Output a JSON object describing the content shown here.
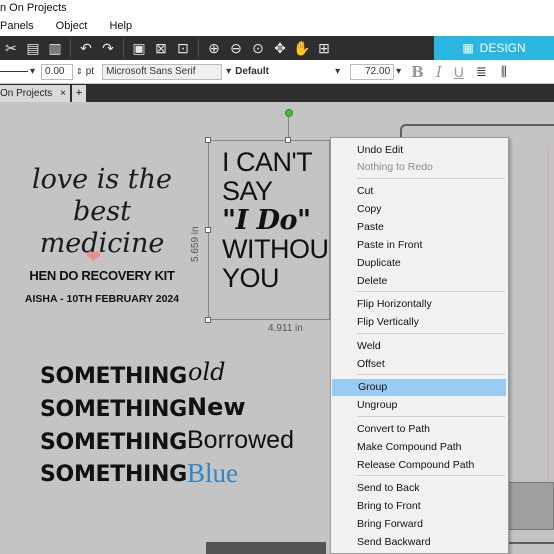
{
  "window": {
    "title": "n On Projects"
  },
  "menu": {
    "items": [
      "Panels",
      "Object",
      "Help"
    ]
  },
  "toolbar": {
    "design_label": "DESIGN"
  },
  "props": {
    "line_value": "0.00",
    "line_unit": "pt",
    "font": "Microsoft Sans Serif",
    "style": "Default",
    "size": "72.00"
  },
  "tabs": {
    "doc": "On Projects",
    "close": "×",
    "add": "+"
  },
  "canvas": {
    "love_line1": "love is the",
    "love_line2": "best medicine",
    "hen_do": "HEN DO RECOVERY KIT",
    "aisha": "AISHA - 10TH FEBRUARY 2024",
    "big_lines": [
      "I CAN'T",
      "SAY",
      "\"I Do\"",
      "WITHOU",
      "YOU"
    ],
    "dim_height": "5.659 in",
    "dim_width": "4.911 in",
    "something": "SOMETHING",
    "words": [
      "old",
      "New",
      "Borrowed",
      "Blue"
    ],
    "accent_blue": "#2f86c8",
    "heart_color": "#ec8d8d"
  },
  "context_menu": {
    "items": [
      "Undo Edit",
      "Nothing to Redo",
      "Cut",
      "Copy",
      "Paste",
      "Paste in Front",
      "Duplicate",
      "Delete",
      "Flip Horizontally",
      "Flip Vertically",
      "Weld",
      "Offset",
      "Group",
      "Ungroup",
      "Convert to Path",
      "Make Compound Path",
      "Release Compound Path",
      "Send to Back",
      "Bring to Front",
      "Bring Forward",
      "Send Backward"
    ],
    "disabled": [
      "Nothing to Redo"
    ],
    "highlighted": "Group"
  }
}
